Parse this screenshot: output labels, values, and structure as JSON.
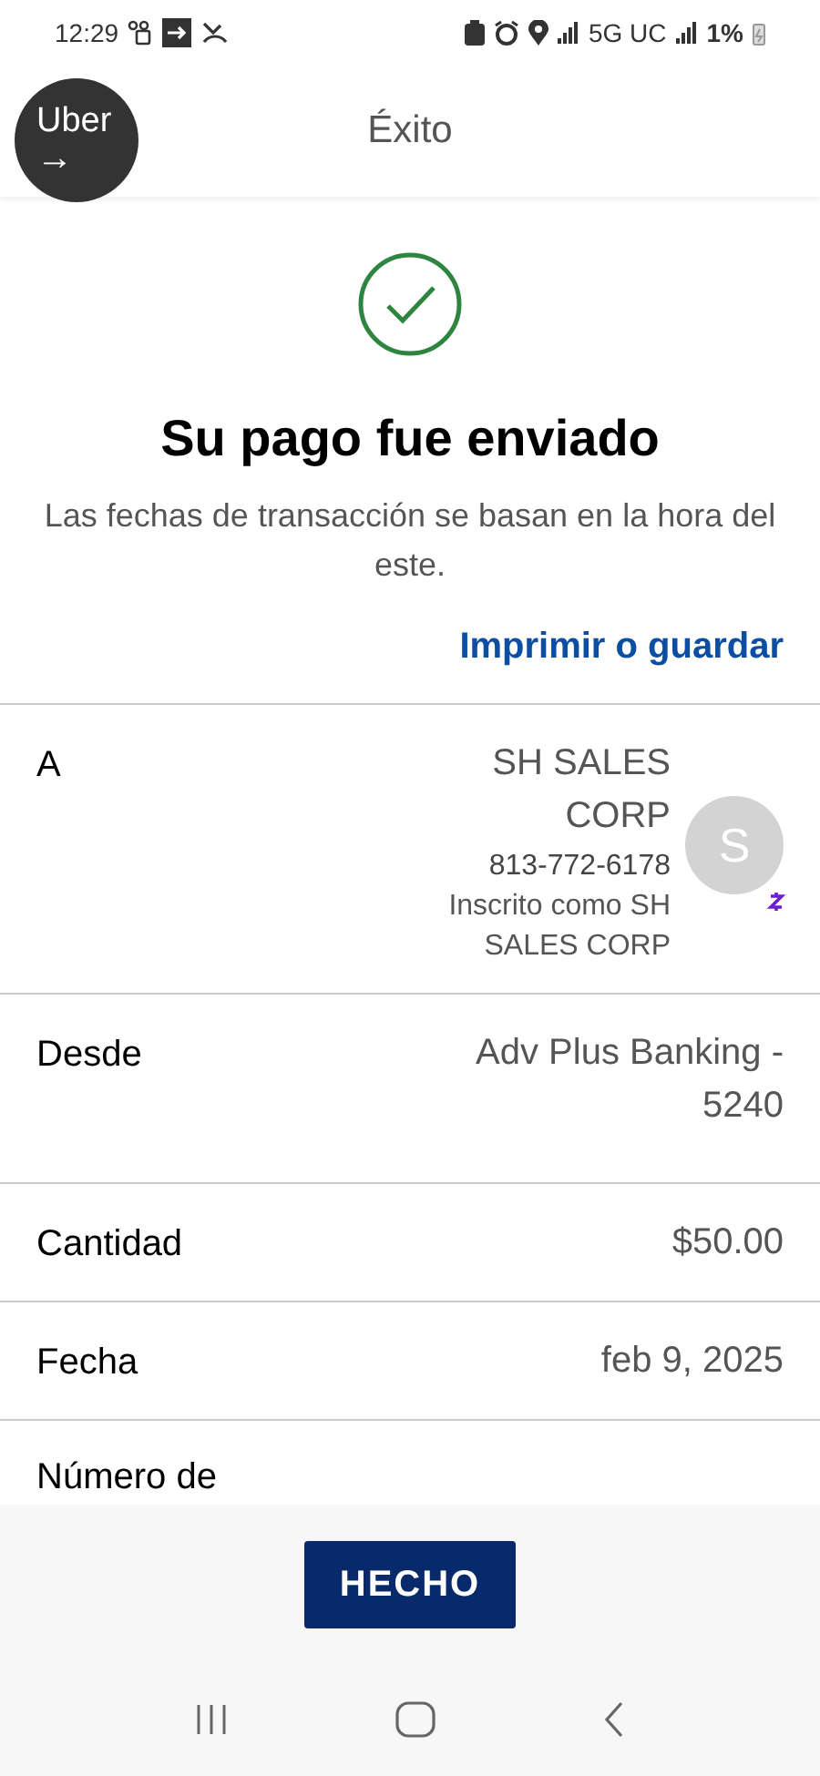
{
  "status_bar": {
    "time": "12:29",
    "network": "5G UC",
    "battery": "1%"
  },
  "header": {
    "title": "Éxito"
  },
  "floating_bubble": {
    "line_1": "Uber",
    "line_2": "→"
  },
  "confirmation": {
    "title": "Su pago fue enviado",
    "subtitle": "Las fechas de transacción se basan en la hora del este.",
    "link": "Imprimir o guardar"
  },
  "details": [
    {
      "kind": "recipient",
      "label": "A",
      "name": "SH SALES CORP",
      "phone": "813-772-6178",
      "note": "Inscrito como SH SALES CORP",
      "avatar_letter": "S"
    },
    {
      "kind": "plain",
      "label": "Desde",
      "value": "Adv Plus Banking - 5240"
    },
    {
      "kind": "plain",
      "label": "Cantidad",
      "value": "$50.00"
    },
    {
      "kind": "plain",
      "label": "Fecha",
      "value": "feb 9, 2025"
    },
    {
      "kind": "partial",
      "label": "Número de"
    }
  ],
  "footer": {
    "button": "HECHO"
  }
}
